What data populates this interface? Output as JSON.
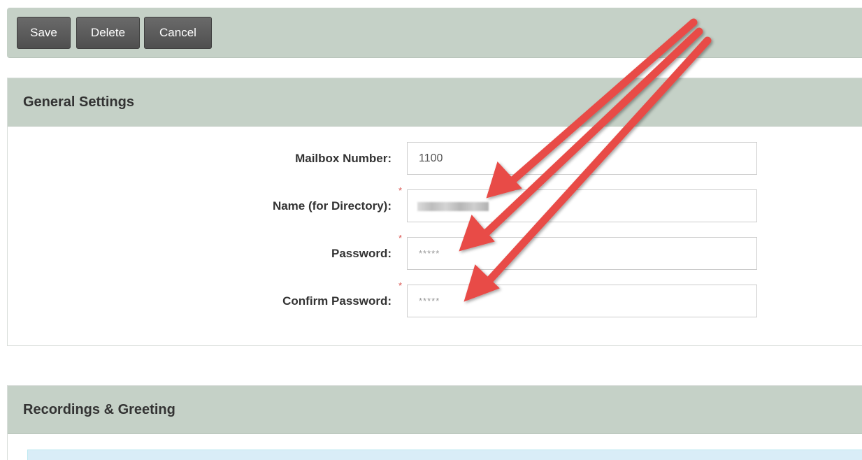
{
  "toolbar": {
    "save_label": "Save",
    "delete_label": "Delete",
    "cancel_label": "Cancel"
  },
  "general_settings": {
    "title": "General Settings",
    "fields": [
      {
        "label": "Mailbox Number:",
        "value": "1100",
        "required": false
      },
      {
        "label": "Name (for Directory):",
        "value": "",
        "required": true,
        "redacted": true
      },
      {
        "label": "Password:",
        "value": "*****",
        "required": true
      },
      {
        "label": "Confirm Password:",
        "value": "*****",
        "required": true
      }
    ],
    "required_marker": "*"
  },
  "recordings": {
    "title": "Recordings & Greeting"
  },
  "colors": {
    "panel_header": "#c5d1c7",
    "button": "#5e5e5e",
    "arrow": "#e84c47",
    "required": "#d9534f",
    "info_box": "#d9edf7"
  },
  "annotations": {
    "icon": "red-arrow-icon",
    "count": 3
  }
}
